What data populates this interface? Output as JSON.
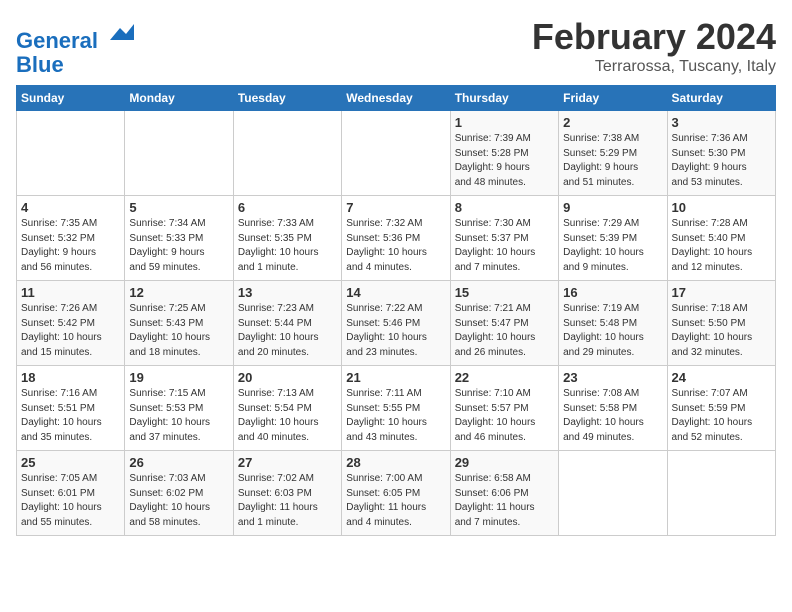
{
  "header": {
    "logo_line1": "General",
    "logo_line2": "Blue",
    "month": "February 2024",
    "location": "Terrarossa, Tuscany, Italy"
  },
  "weekdays": [
    "Sunday",
    "Monday",
    "Tuesday",
    "Wednesday",
    "Thursday",
    "Friday",
    "Saturday"
  ],
  "weeks": [
    [
      {
        "day": "",
        "info": ""
      },
      {
        "day": "",
        "info": ""
      },
      {
        "day": "",
        "info": ""
      },
      {
        "day": "",
        "info": ""
      },
      {
        "day": "1",
        "info": "Sunrise: 7:39 AM\nSunset: 5:28 PM\nDaylight: 9 hours\nand 48 minutes."
      },
      {
        "day": "2",
        "info": "Sunrise: 7:38 AM\nSunset: 5:29 PM\nDaylight: 9 hours\nand 51 minutes."
      },
      {
        "day": "3",
        "info": "Sunrise: 7:36 AM\nSunset: 5:30 PM\nDaylight: 9 hours\nand 53 minutes."
      }
    ],
    [
      {
        "day": "4",
        "info": "Sunrise: 7:35 AM\nSunset: 5:32 PM\nDaylight: 9 hours\nand 56 minutes."
      },
      {
        "day": "5",
        "info": "Sunrise: 7:34 AM\nSunset: 5:33 PM\nDaylight: 9 hours\nand 59 minutes."
      },
      {
        "day": "6",
        "info": "Sunrise: 7:33 AM\nSunset: 5:35 PM\nDaylight: 10 hours\nand 1 minute."
      },
      {
        "day": "7",
        "info": "Sunrise: 7:32 AM\nSunset: 5:36 PM\nDaylight: 10 hours\nand 4 minutes."
      },
      {
        "day": "8",
        "info": "Sunrise: 7:30 AM\nSunset: 5:37 PM\nDaylight: 10 hours\nand 7 minutes."
      },
      {
        "day": "9",
        "info": "Sunrise: 7:29 AM\nSunset: 5:39 PM\nDaylight: 10 hours\nand 9 minutes."
      },
      {
        "day": "10",
        "info": "Sunrise: 7:28 AM\nSunset: 5:40 PM\nDaylight: 10 hours\nand 12 minutes."
      }
    ],
    [
      {
        "day": "11",
        "info": "Sunrise: 7:26 AM\nSunset: 5:42 PM\nDaylight: 10 hours\nand 15 minutes."
      },
      {
        "day": "12",
        "info": "Sunrise: 7:25 AM\nSunset: 5:43 PM\nDaylight: 10 hours\nand 18 minutes."
      },
      {
        "day": "13",
        "info": "Sunrise: 7:23 AM\nSunset: 5:44 PM\nDaylight: 10 hours\nand 20 minutes."
      },
      {
        "day": "14",
        "info": "Sunrise: 7:22 AM\nSunset: 5:46 PM\nDaylight: 10 hours\nand 23 minutes."
      },
      {
        "day": "15",
        "info": "Sunrise: 7:21 AM\nSunset: 5:47 PM\nDaylight: 10 hours\nand 26 minutes."
      },
      {
        "day": "16",
        "info": "Sunrise: 7:19 AM\nSunset: 5:48 PM\nDaylight: 10 hours\nand 29 minutes."
      },
      {
        "day": "17",
        "info": "Sunrise: 7:18 AM\nSunset: 5:50 PM\nDaylight: 10 hours\nand 32 minutes."
      }
    ],
    [
      {
        "day": "18",
        "info": "Sunrise: 7:16 AM\nSunset: 5:51 PM\nDaylight: 10 hours\nand 35 minutes."
      },
      {
        "day": "19",
        "info": "Sunrise: 7:15 AM\nSunset: 5:53 PM\nDaylight: 10 hours\nand 37 minutes."
      },
      {
        "day": "20",
        "info": "Sunrise: 7:13 AM\nSunset: 5:54 PM\nDaylight: 10 hours\nand 40 minutes."
      },
      {
        "day": "21",
        "info": "Sunrise: 7:11 AM\nSunset: 5:55 PM\nDaylight: 10 hours\nand 43 minutes."
      },
      {
        "day": "22",
        "info": "Sunrise: 7:10 AM\nSunset: 5:57 PM\nDaylight: 10 hours\nand 46 minutes."
      },
      {
        "day": "23",
        "info": "Sunrise: 7:08 AM\nSunset: 5:58 PM\nDaylight: 10 hours\nand 49 minutes."
      },
      {
        "day": "24",
        "info": "Sunrise: 7:07 AM\nSunset: 5:59 PM\nDaylight: 10 hours\nand 52 minutes."
      }
    ],
    [
      {
        "day": "25",
        "info": "Sunrise: 7:05 AM\nSunset: 6:01 PM\nDaylight: 10 hours\nand 55 minutes."
      },
      {
        "day": "26",
        "info": "Sunrise: 7:03 AM\nSunset: 6:02 PM\nDaylight: 10 hours\nand 58 minutes."
      },
      {
        "day": "27",
        "info": "Sunrise: 7:02 AM\nSunset: 6:03 PM\nDaylight: 11 hours\nand 1 minute."
      },
      {
        "day": "28",
        "info": "Sunrise: 7:00 AM\nSunset: 6:05 PM\nDaylight: 11 hours\nand 4 minutes."
      },
      {
        "day": "29",
        "info": "Sunrise: 6:58 AM\nSunset: 6:06 PM\nDaylight: 11 hours\nand 7 minutes."
      },
      {
        "day": "",
        "info": ""
      },
      {
        "day": "",
        "info": ""
      }
    ]
  ]
}
